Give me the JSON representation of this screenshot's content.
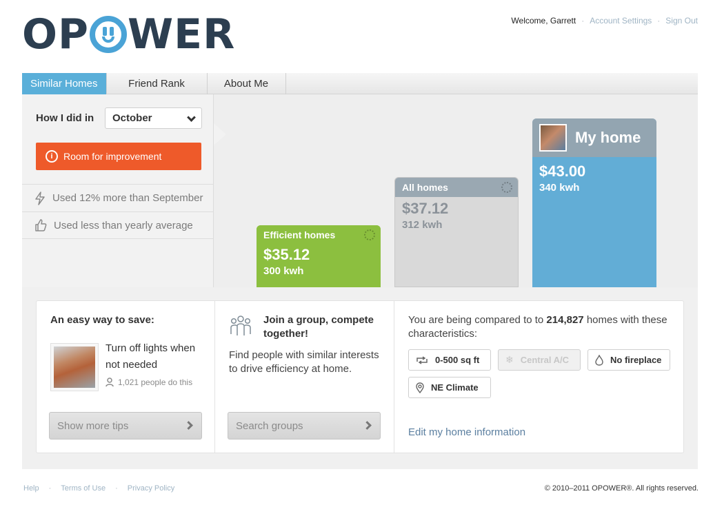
{
  "brand": {
    "logo_text_left": "OP",
    "logo_text_right": "WER"
  },
  "user_nav": {
    "welcome": "Welcome, Garrett",
    "separator": "·",
    "account_settings": "Account Settings",
    "sign_out": "Sign Out"
  },
  "tabs": [
    {
      "label": "Similar Homes",
      "active": true
    },
    {
      "label": "Friend Rank",
      "active": false
    },
    {
      "label": "About Me",
      "active": false
    }
  ],
  "summary": {
    "how_label": "How I did in",
    "month": "October",
    "status": "Room for improvement",
    "stats": [
      {
        "icon": "lightning-icon",
        "text": "Used 12% more than September"
      },
      {
        "icon": "thumbs-up-icon",
        "text": "Used less than yearly average"
      }
    ]
  },
  "comparison": {
    "bars": [
      {
        "key": "efficient",
        "label": "Efficient homes",
        "amount": "$35.12",
        "kwh": "300 kwh"
      },
      {
        "key": "all",
        "label": "All homes",
        "amount": "$37.12",
        "kwh": "312 kwh"
      },
      {
        "key": "mine",
        "label": "My home",
        "amount": "$43.00",
        "kwh": "340 kwh"
      }
    ]
  },
  "tips": {
    "title": "An easy way to save:",
    "tip_text": "Turn off lights when not needed",
    "people_count": "1,021 people do this",
    "button": "Show more tips"
  },
  "groups": {
    "title": "Join a group, compete together!",
    "description": "Find people with similar interests to drive efficiency at home.",
    "button": "Search groups"
  },
  "characteristics": {
    "prefix": "You are being compared to to ",
    "count": "214,827",
    "suffix": " homes with these characteristics:",
    "chips": [
      {
        "icon": "repeat-icon",
        "label": "0-500 sq ft",
        "enabled": true
      },
      {
        "icon": "snowflake-icon",
        "label": "Central A/C",
        "enabled": false
      },
      {
        "icon": "flame-icon",
        "label": "No fireplace",
        "enabled": true
      },
      {
        "icon": "location-pin-icon",
        "label": "NE Climate",
        "enabled": true
      }
    ],
    "edit_link": "Edit my home information"
  },
  "footer": {
    "links": [
      "Help",
      "Terms of Use",
      "Privacy Policy"
    ],
    "separator": "·",
    "copyright": "© 2010–2011 OPOWER®. All rights reserved."
  },
  "colors": {
    "accent_blue": "#5aafd9",
    "alert_orange": "#ee5a2a",
    "efficient_green": "#8cbf3f",
    "all_homes_grey": "#9aa8b2",
    "my_home_blue": "#62add6",
    "logo_navy": "#2c3e50"
  }
}
